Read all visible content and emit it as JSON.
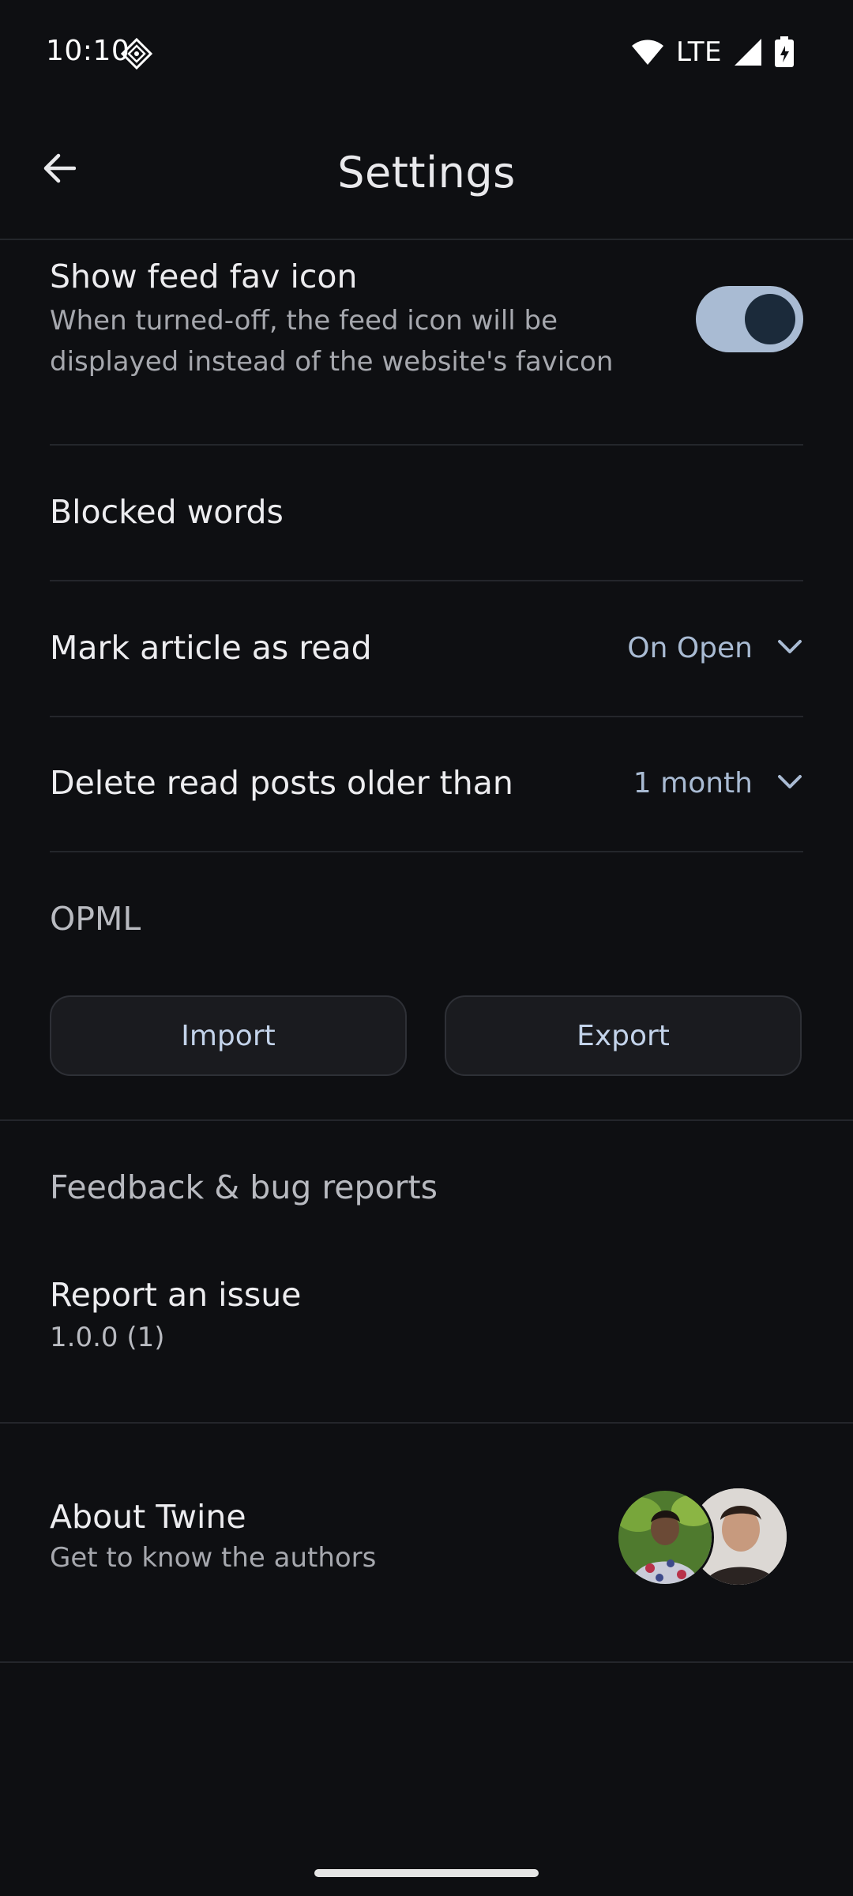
{
  "status_bar": {
    "time": "10:10",
    "network": "LTE",
    "icons": [
      "vpn-diamond-icon",
      "wifi-icon",
      "signal-icon",
      "battery-icon"
    ]
  },
  "header": {
    "title": "Settings",
    "back_icon": "arrow-left-icon"
  },
  "settings": {
    "show_fav_icon": {
      "title": "Show feed fav icon",
      "subtitle_line1": "When turned-off, the feed icon will be",
      "subtitle_line2": "displayed instead of the website's favicon",
      "enabled": true
    },
    "blocked_words": {
      "title": "Blocked words"
    },
    "mark_read": {
      "title": "Mark article as read",
      "value": "On Open"
    },
    "delete_old": {
      "title": "Delete read posts older than",
      "value": "1 month"
    }
  },
  "opml": {
    "heading": "OPML",
    "import_label": "Import",
    "export_label": "Export"
  },
  "feedback": {
    "heading": "Feedback & bug reports",
    "report_title": "Report an issue",
    "version": "1.0.0 (1)"
  },
  "about": {
    "title": "About Twine",
    "subtitle": "Get to know the authors"
  },
  "colors": {
    "background": "#0e0f12",
    "accent": "#a9bbd3",
    "divider": "#24262b"
  }
}
